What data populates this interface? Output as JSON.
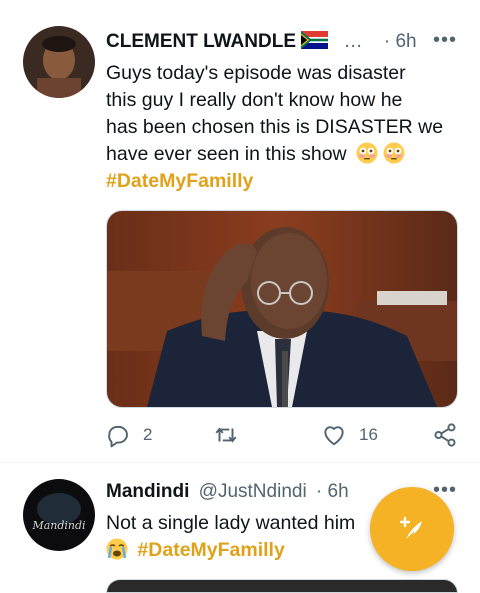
{
  "tweets": [
    {
      "display_name": "CLEMENT LWANDLE",
      "flag_icon": "south-africa-flag-icon",
      "handle_truncated": "…",
      "time": "· 6h",
      "text_lines": [
        "Guys today's episode was disaster",
        "this guy I really don't know how he",
        "has been chosen this is DISASTER we",
        "have ever seen in this show"
      ],
      "emojis": [
        "flushed-face-emoji",
        "flushed-face-emoji"
      ],
      "hashtag": "#DateMyFamilly",
      "replies": "2",
      "likes": "16"
    },
    {
      "display_name": "Mandindi",
      "handle": "@JustNdindi",
      "time": "· 6h",
      "text": "Not a single lady wanted him",
      "emoji": "crying-face-emoji",
      "hashtag": "#DateMyFamilly"
    }
  ],
  "colors": {
    "accent": "#f4b224",
    "hashtag": "#e0a21b",
    "muted": "#536471"
  }
}
